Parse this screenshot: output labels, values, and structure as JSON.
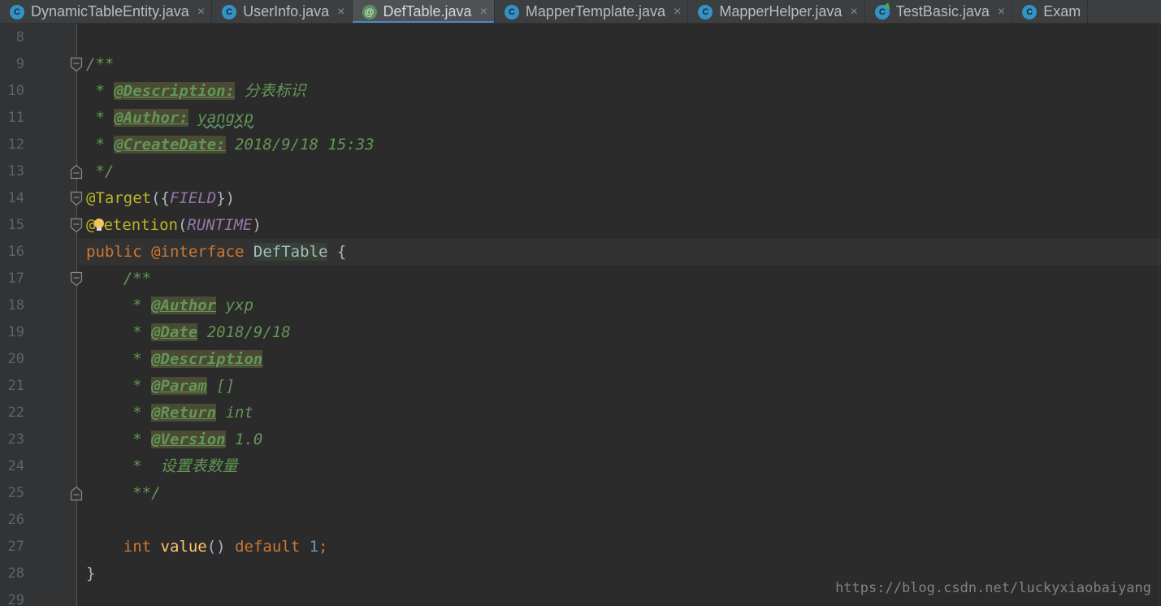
{
  "tabs": [
    {
      "label": "DynamicTableEntity.java",
      "kind": "class",
      "active": false
    },
    {
      "label": "UserInfo.java",
      "kind": "class",
      "active": false
    },
    {
      "label": "DefTable.java",
      "kind": "annotation",
      "active": true
    },
    {
      "label": "MapperTemplate.java",
      "kind": "class",
      "active": false
    },
    {
      "label": "MapperHelper.java",
      "kind": "class",
      "active": false
    },
    {
      "label": "TestBasic.java",
      "kind": "test",
      "active": false
    },
    {
      "label": "Exam",
      "kind": "class",
      "active": false
    }
  ],
  "tab_close_glyph": "×",
  "tab_icon_class_glyph": "C",
  "tab_icon_annotation_glyph": "@",
  "editor": {
    "lines": [
      {
        "n": "8",
        "parts": []
      },
      {
        "n": "9",
        "parts": [
          {
            "t": "/**",
            "c": "cmt"
          }
        ]
      },
      {
        "n": "10",
        "parts": [
          {
            "t": " * ",
            "c": "cmt"
          },
          {
            "t": "@Description:",
            "c": "tag tag-hl"
          },
          {
            "t": " 分表标识",
            "c": "cmt"
          }
        ]
      },
      {
        "n": "11",
        "parts": [
          {
            "t": " * ",
            "c": "cmt"
          },
          {
            "t": "@Author:",
            "c": "tag tag-hl"
          },
          {
            "t": " ",
            "c": "cmt"
          },
          {
            "t": "yangxp",
            "c": "cmt tilde"
          }
        ]
      },
      {
        "n": "12",
        "parts": [
          {
            "t": " * ",
            "c": "cmt"
          },
          {
            "t": "@CreateDate:",
            "c": "tag tag-hl"
          },
          {
            "t": " 2018/9/18 15:33",
            "c": "cmt"
          }
        ]
      },
      {
        "n": "13",
        "parts": [
          {
            "t": " */",
            "c": "cmt"
          }
        ]
      },
      {
        "n": "14",
        "parts": [
          {
            "t": "@Target",
            "c": "anno"
          },
          {
            "t": "({",
            "c": "plain"
          },
          {
            "t": "FIELD",
            "c": "const"
          },
          {
            "t": "})",
            "c": "plain"
          }
        ]
      },
      {
        "n": "15",
        "parts": [
          {
            "t": "@",
            "c": "anno"
          },
          {
            "t": "BULB",
            "c": "bulb"
          },
          {
            "t": "etention",
            "c": "anno"
          },
          {
            "t": "(",
            "c": "plain"
          },
          {
            "t": "RUNTIME",
            "c": "const"
          },
          {
            "t": ")",
            "c": "plain"
          }
        ]
      },
      {
        "n": "16",
        "parts": [
          {
            "t": "public ",
            "c": "kw"
          },
          {
            "t": "@interface ",
            "c": "kw"
          },
          {
            "t": "DefTable",
            "c": "cls"
          },
          {
            "t": " {",
            "c": "plain"
          }
        ]
      },
      {
        "n": "17",
        "parts": [
          {
            "t": "    /**",
            "c": "cmt"
          }
        ]
      },
      {
        "n": "18",
        "parts": [
          {
            "t": "     * ",
            "c": "cmt"
          },
          {
            "t": "@Author",
            "c": "tag tag-hl"
          },
          {
            "t": " yxp",
            "c": "cmt"
          }
        ]
      },
      {
        "n": "19",
        "parts": [
          {
            "t": "     * ",
            "c": "cmt"
          },
          {
            "t": "@Date",
            "c": "tag tag-hl"
          },
          {
            "t": " 2018/9/18",
            "c": "cmt"
          }
        ]
      },
      {
        "n": "20",
        "parts": [
          {
            "t": "     * ",
            "c": "cmt"
          },
          {
            "t": "@Description",
            "c": "tag tag-hl"
          }
        ]
      },
      {
        "n": "21",
        "parts": [
          {
            "t": "     * ",
            "c": "cmt"
          },
          {
            "t": "@Param",
            "c": "tag tag-hl"
          },
          {
            "t": " []",
            "c": "cmt"
          }
        ]
      },
      {
        "n": "22",
        "parts": [
          {
            "t": "     * ",
            "c": "cmt"
          },
          {
            "t": "@Return",
            "c": "tag tag-hl"
          },
          {
            "t": " int",
            "c": "cmt"
          }
        ]
      },
      {
        "n": "23",
        "parts": [
          {
            "t": "     * ",
            "c": "cmt"
          },
          {
            "t": "@Version",
            "c": "tag tag-hl"
          },
          {
            "t": " 1.0",
            "c": "cmt"
          }
        ]
      },
      {
        "n": "24",
        "parts": [
          {
            "t": "     *  设置表数量",
            "c": "cmt"
          }
        ]
      },
      {
        "n": "25",
        "parts": [
          {
            "t": "     **/",
            "c": "cmt"
          }
        ]
      },
      {
        "n": "26",
        "parts": []
      },
      {
        "n": "27",
        "parts": [
          {
            "t": "    ",
            "c": "plain"
          },
          {
            "t": "int ",
            "c": "kw"
          },
          {
            "t": "value",
            "c": "fn"
          },
          {
            "t": "() ",
            "c": "plain"
          },
          {
            "t": "default ",
            "c": "kw"
          },
          {
            "t": "1",
            "c": "num"
          },
          {
            "t": ";",
            "c": "kw"
          }
        ]
      },
      {
        "n": "28",
        "parts": [
          {
            "t": "}",
            "c": "plain"
          }
        ]
      },
      {
        "n": "29",
        "parts": []
      }
    ],
    "fold_open_lines": [
      "9",
      "14",
      "15",
      "17"
    ],
    "fold_close_lines": [
      "13",
      "25"
    ],
    "current_line": "16"
  },
  "watermark": "https://blog.csdn.net/luckyxiaobaiyang",
  "colors": {
    "background": "#2b2b2b",
    "gutter": "#313335",
    "comment": "#629755",
    "keyword": "#cc7832",
    "annotation": "#bbb529",
    "constant": "#9876aa",
    "tab_active_underline": "#4a88c7"
  }
}
